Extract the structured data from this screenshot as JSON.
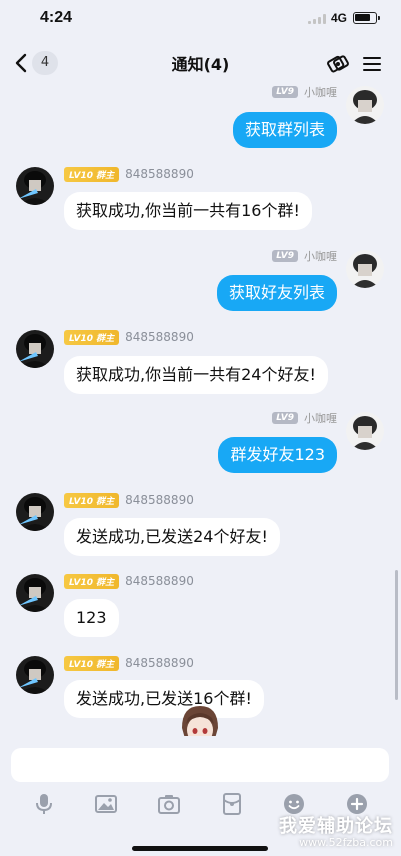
{
  "status_bar": {
    "time": "4:24",
    "network": "4G"
  },
  "nav": {
    "back_count": "4",
    "title": "通知(4)"
  },
  "messages": [
    {
      "side": "right",
      "level": "LV9",
      "name": "小咖喱",
      "text": "获取群列表"
    },
    {
      "side": "left",
      "level": "LV10 群主",
      "name": "848588890",
      "text": "获取成功,你当前一共有16个群!"
    },
    {
      "side": "right",
      "level": "LV9",
      "name": "小咖喱",
      "text": "获取好友列表"
    },
    {
      "side": "left",
      "level": "LV10 群主",
      "name": "848588890",
      "text": "获取成功,你当前一共有24个好友!"
    },
    {
      "side": "right",
      "level": "LV9",
      "name": "小咖喱",
      "text": "群发好友123"
    },
    {
      "side": "left",
      "level": "LV10 群主",
      "name": "848588890",
      "text": "发送成功,已发送24个好友!"
    },
    {
      "side": "left",
      "level": "LV10 群主",
      "name": "848588890",
      "text": "123"
    },
    {
      "side": "left",
      "level": "LV10 群主",
      "name": "848588890",
      "text": "发送成功,已发送16个群!"
    }
  ],
  "input": {
    "placeholder": ""
  },
  "toolbar": [
    "microphone-icon",
    "image-icon",
    "camera-icon",
    "red-packet-icon",
    "emoji-icon",
    "plus-icon"
  ],
  "watermark": {
    "title": "我爱辅助论坛",
    "url": "www.52fzba.com"
  },
  "colors": {
    "bubble_blue": "#18a8f5",
    "background": "#eef0f7",
    "level_gold": "#f6c843",
    "level_gray": "#b4b8c4"
  }
}
